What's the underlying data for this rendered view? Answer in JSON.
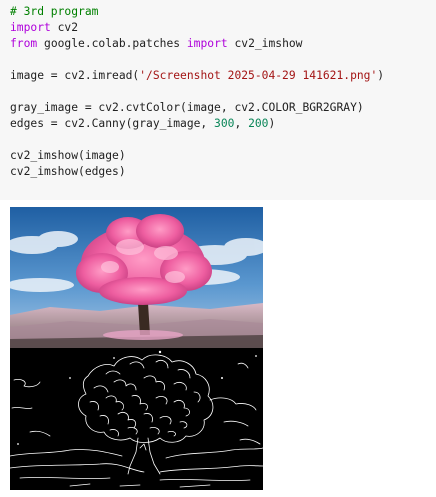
{
  "code_cell": {
    "lines": [
      [
        {
          "t": "# 3rd program",
          "c": "comment"
        }
      ],
      [
        {
          "t": "import",
          "c": "keyword"
        },
        {
          "t": " cv2",
          "c": "plain"
        }
      ],
      [
        {
          "t": "from",
          "c": "keyword"
        },
        {
          "t": " google.colab.patches ",
          "c": "plain"
        },
        {
          "t": "import",
          "c": "keyword"
        },
        {
          "t": " cv2_imshow",
          "c": "plain"
        }
      ],
      [],
      [
        {
          "t": "image = cv2.imread(",
          "c": "plain"
        },
        {
          "t": "'/Screenshot 2025-04-29 141621.png'",
          "c": "string"
        },
        {
          "t": ")",
          "c": "plain"
        }
      ],
      [],
      [
        {
          "t": "gray_image = cv2.cvtColor(image, cv2.COLOR_BGR2GRAY)",
          "c": "plain"
        }
      ],
      [
        {
          "t": "edges = cv2.Canny(gray_image, ",
          "c": "plain"
        },
        {
          "t": "300",
          "c": "number"
        },
        {
          "t": ", ",
          "c": "plain"
        },
        {
          "t": "200",
          "c": "number"
        },
        {
          "t": ")",
          "c": "plain"
        }
      ],
      [],
      [
        {
          "t": "cv2_imshow(image)",
          "c": "plain"
        }
      ],
      [
        {
          "t": "cv2_imshow(edges)",
          "c": "plain"
        }
      ]
    ]
  },
  "outputs": [
    {
      "kind": "color-photo",
      "subject": "pink-blossom-tree"
    },
    {
      "kind": "edge-map",
      "subject": "canny-edges-of-tree"
    }
  ],
  "colors": {
    "cell_background": "#f7f7f7",
    "comment": "#008000",
    "keyword": "#af00db",
    "string": "#a31515",
    "number": "#098658",
    "plain": "#212121",
    "edge_background": "#000000",
    "edge_lines": "#ffffff",
    "blossom": "#e8609a",
    "sky": "#3f7fbf"
  }
}
